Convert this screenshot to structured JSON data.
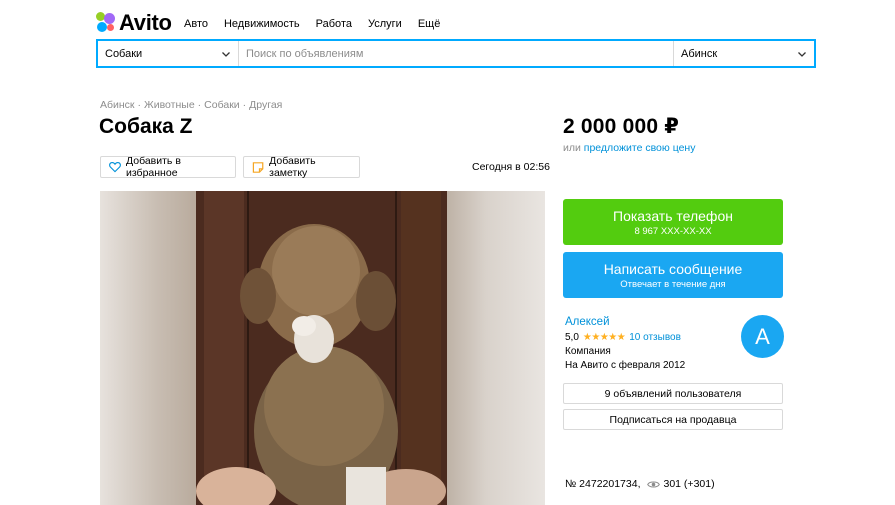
{
  "header": {
    "logo_text": "Avito",
    "nav": [
      "Авто",
      "Недвижимость",
      "Работа",
      "Услуги",
      "Ещё"
    ]
  },
  "search": {
    "category": "Собаки",
    "placeholder": "Поиск по объявлениям",
    "location": "Абинск"
  },
  "breadcrumbs": [
    "Абинск",
    "Животные",
    "Собаки",
    "Другая"
  ],
  "listing": {
    "title": "Собака Z",
    "favorite_label": "Добавить в избранное",
    "note_label": "Добавить заметку",
    "date": "Сегодня в 02:56",
    "price": "2 000 000 ₽",
    "price_prefix": "или",
    "price_offer_link": "предложите свою цену",
    "number": "№ 2472201734,",
    "views": "301 (+301)"
  },
  "actions": {
    "show_phone_label": "Показать телефон",
    "phone_masked": "8 967 XXX-XX-XX",
    "message_label": "Написать сообщение",
    "message_sub": "Отвечает в течение дня"
  },
  "seller": {
    "name": "Алексей",
    "rating_value": "5,0",
    "rating_stars": 5,
    "stars_text": "★★★★★",
    "reviews": "10 отзывов",
    "type": "Компания",
    "since": "На Авито с февраля 2012",
    "avatar_letter": "А",
    "ads_button": "9 объявлений пользователя",
    "subscribe_button": "Подписаться на продавца"
  },
  "colors": {
    "accent": "#00aaff",
    "phone_button": "#53cc0f",
    "message_button": "#1aa7f2",
    "link": "#0091d9",
    "stars": "#ffb021"
  },
  "icons": {
    "favorite": "heart-icon",
    "note": "note-icon",
    "views": "eye-icon",
    "dropdown": "chevron-down-icon"
  }
}
